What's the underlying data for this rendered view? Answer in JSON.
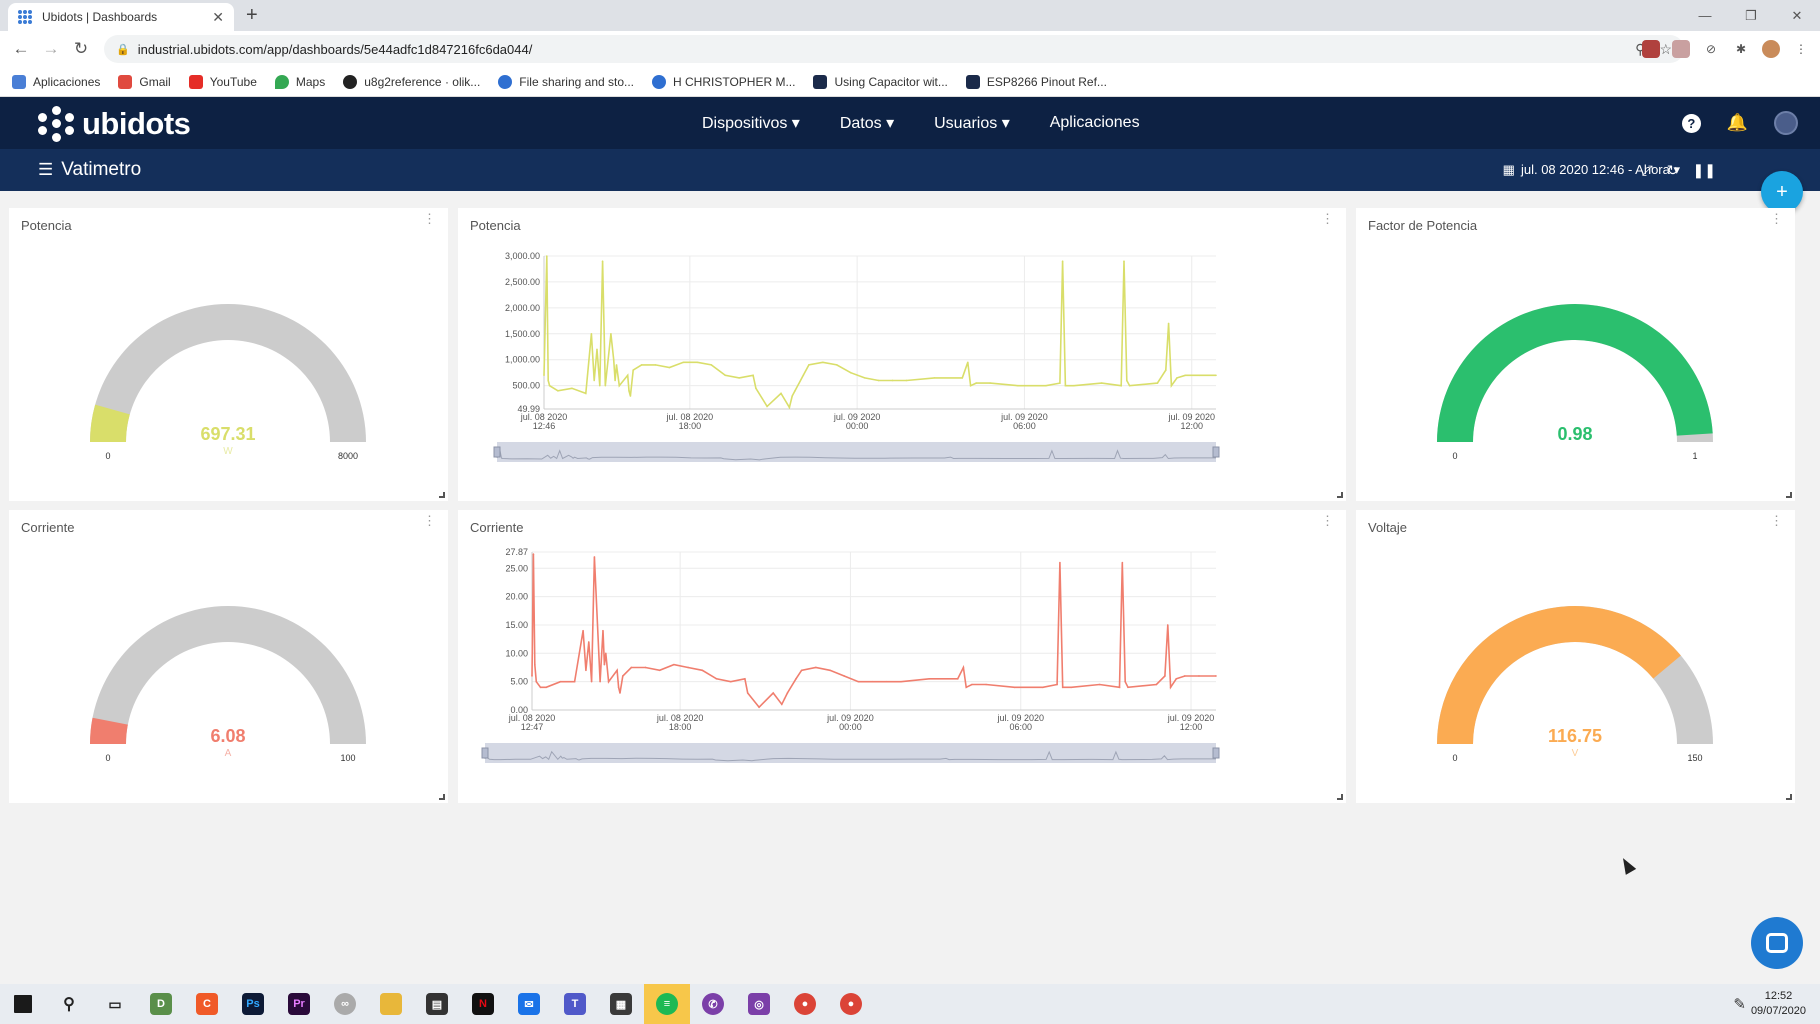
{
  "browser": {
    "tab_title": "Ubidots | Dashboards",
    "url": "industrial.ubidots.com/app/dashboards/5e44adfc1d847216fc6da044/",
    "bookmarks": [
      "Aplicaciones",
      "Gmail",
      "YouTube",
      "Maps",
      "u8g2reference · olik...",
      "File sharing and sto...",
      "H CHRISTOPHER M...",
      "Using Capacitor wit...",
      "ESP8266 Pinout Ref..."
    ]
  },
  "app": {
    "logo_text": "ubidots",
    "nav": [
      "Dispositivos ▾",
      "Datos ▾",
      "Usuarios ▾",
      "Aplicaciones"
    ],
    "dashboard_title": "Vatimetro",
    "date_range": "jul. 08 2020 12:46 - Ahora ▾",
    "fab_label": "+"
  },
  "widgets": {
    "potencia_gauge": {
      "title": "Potencia",
      "value": "697.31",
      "unit": "W",
      "min": "0",
      "max": "8000",
      "fraction": 0.0872,
      "color": "#d9de6a"
    },
    "factor_gauge": {
      "title": "Factor de Potencia",
      "value": "0.98",
      "unit": "",
      "min": "0",
      "max": "1",
      "fraction": 0.98,
      "color": "#2bbf6e"
    },
    "corriente_gauge": {
      "title": "Corriente",
      "value": "6.08",
      "unit": "A",
      "min": "0",
      "max": "100",
      "fraction": 0.0608,
      "color": "#f07e6e"
    },
    "voltaje_gauge": {
      "title": "Voltaje",
      "value": "116.75",
      "unit": "V",
      "min": "0",
      "max": "150",
      "fraction": 0.7783,
      "color": "#fbab52"
    }
  },
  "chart_data": [
    {
      "type": "line",
      "title": "Potencia",
      "color": "#d9de6a",
      "y_ticks": [
        "49.99",
        "500.00",
        "1,000.00",
        "1,500.00",
        "2,000.00",
        "2,500.00",
        "3,000.00"
      ],
      "ylim": [
        49.99,
        3000
      ],
      "x_ticks": [
        [
          "jul. 08 2020",
          "12:46"
        ],
        [
          "jul. 08 2020",
          "18:00"
        ],
        [
          "jul. 09 2020",
          "00:00"
        ],
        [
          "jul. 09 2020",
          "06:00"
        ],
        [
          "jul. 09 2020",
          "12:00"
        ]
      ],
      "xlim_hours": [
        0,
        24.1
      ],
      "tick_hours": [
        0,
        5.23,
        11.23,
        17.23,
        23.23
      ],
      "x_hours": [
        0,
        0.1,
        0.15,
        0.2,
        0.5,
        1,
        1.5,
        1.7,
        1.8,
        1.9,
        2.0,
        2.1,
        2.2,
        2.4,
        2.5,
        2.55,
        2.6,
        2.7,
        3.0,
        3.05,
        3.1,
        3.2,
        3.5,
        4,
        4.5,
        5,
        5.5,
        6,
        6.5,
        7,
        7.5,
        7.6,
        8,
        8.5,
        8.8,
        8.9,
        9.0,
        9.3,
        9.5,
        10,
        10.5,
        11,
        11.5,
        12,
        12.5,
        13,
        14,
        15,
        15.2,
        15.3,
        15.5,
        16,
        17,
        18,
        18.5,
        18.6,
        18.7,
        19,
        20,
        20.7,
        20.8,
        20.9,
        21,
        22,
        22.3,
        22.4,
        22.5,
        22.7,
        23,
        23.5,
        24.1
      ],
      "values": [
        700,
        3000,
        600,
        500,
        400,
        450,
        350,
        1500,
        600,
        1200,
        500,
        2900,
        500,
        1500,
        1000,
        600,
        900,
        500,
        700,
        400,
        300,
        800,
        900,
        900,
        850,
        950,
        950,
        900,
        700,
        650,
        700,
        450,
        100,
        350,
        80,
        300,
        400,
        700,
        900,
        950,
        900,
        750,
        650,
        600,
        600,
        600,
        650,
        650,
        950,
        500,
        550,
        550,
        500,
        500,
        550,
        2900,
        500,
        500,
        550,
        500,
        2900,
        600,
        500,
        550,
        800,
        1700,
        500,
        650,
        700,
        700,
        700
      ]
    },
    {
      "type": "line",
      "title": "Corriente",
      "color": "#f07e6e",
      "y_ticks": [
        "0.00",
        "5.00",
        "10.00",
        "15.00",
        "20.00",
        "25.00",
        "27.87"
      ],
      "ylim": [
        0,
        27.87
      ],
      "x_ticks": [
        [
          "jul. 08 2020",
          "12:47"
        ],
        [
          "jul. 08 2020",
          "18:00"
        ],
        [
          "jul. 09 2020",
          "00:00"
        ],
        [
          "jul. 09 2020",
          "06:00"
        ],
        [
          "jul. 09 2020",
          "12:00"
        ]
      ],
      "xlim_hours": [
        0,
        24.1
      ],
      "tick_hours": [
        0,
        5.22,
        11.22,
        17.22,
        23.22
      ],
      "x_hours": [
        0,
        0.05,
        0.1,
        0.15,
        0.3,
        0.5,
        1,
        1.5,
        1.8,
        1.9,
        2.0,
        2.1,
        2.2,
        2.4,
        2.5,
        2.55,
        2.6,
        2.7,
        3.0,
        3.05,
        3.1,
        3.2,
        3.5,
        4,
        4.5,
        5,
        5.5,
        6,
        6.5,
        7,
        7.5,
        7.6,
        8,
        8.5,
        8.8,
        8.9,
        9.0,
        9.3,
        9.5,
        10,
        10.5,
        11,
        11.5,
        12,
        12.5,
        13,
        14,
        15,
        15.2,
        15.3,
        15.5,
        16,
        17,
        18,
        18.5,
        18.6,
        18.7,
        19,
        20,
        20.7,
        20.8,
        20.9,
        21,
        22,
        22.3,
        22.4,
        22.5,
        22.7,
        23,
        23.5,
        24.1
      ],
      "values": [
        6,
        27.5,
        8,
        5,
        4,
        4,
        5,
        5,
        14,
        7,
        12,
        5,
        27,
        5,
        14,
        8,
        10,
        5,
        7,
        4,
        3,
        6,
        7.5,
        7.5,
        7,
        8,
        7.5,
        7,
        5.5,
        5,
        5.5,
        3,
        0.5,
        3,
        1,
        2,
        3,
        5.5,
        7,
        7.5,
        7,
        6,
        5,
        5,
        5,
        5,
        5.5,
        5.5,
        7.5,
        4,
        4.5,
        4.5,
        4,
        4,
        4.5,
        26,
        4,
        4,
        4.5,
        4,
        26,
        5,
        4,
        4.5,
        6,
        15,
        4,
        5.5,
        6,
        6,
        6
      ]
    }
  ],
  "taskbar": {
    "time": "12:52",
    "date": "09/07/2020"
  }
}
